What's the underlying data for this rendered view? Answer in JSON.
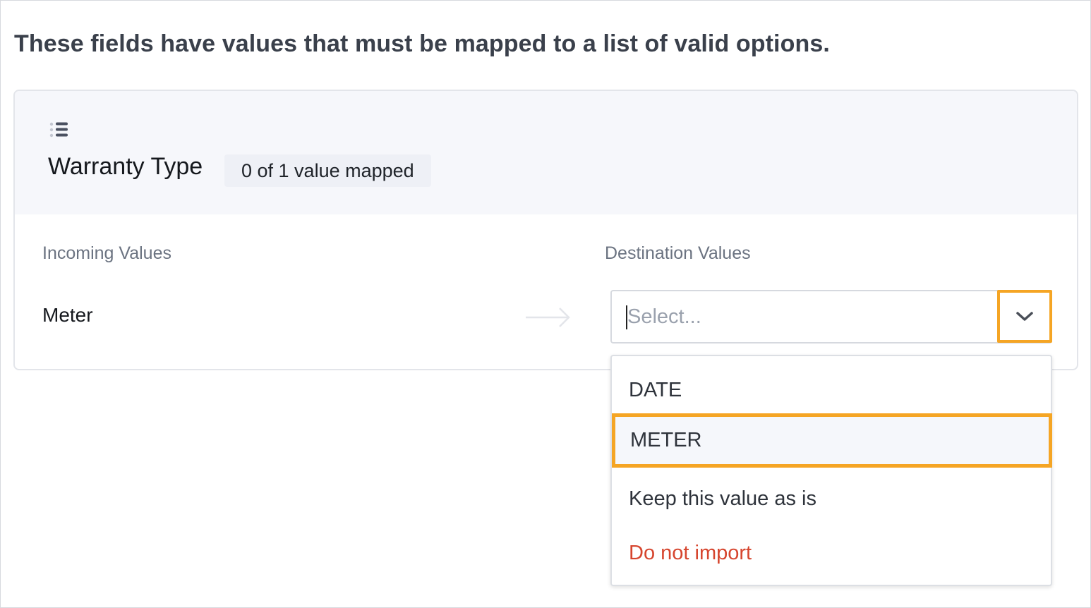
{
  "heading": "These fields have values that must be mapped to a list of valid options.",
  "field": {
    "icon": "list-icon",
    "name": "Warranty Type",
    "mapped_status": "0 of 1 value mapped"
  },
  "columns": {
    "incoming": "Incoming Values",
    "destination": "Destination Values"
  },
  "row": {
    "incoming_value": "Meter",
    "arrow_icon": "arrow-right-icon",
    "select": {
      "value": "",
      "placeholder": "Select...",
      "toggle_icon": "chevron-down-icon"
    }
  },
  "dropdown": {
    "options": [
      {
        "label": "DATE"
      },
      {
        "label": "METER",
        "highlighted": true
      },
      {
        "label": "Keep this value as is"
      },
      {
        "label": "Do not import",
        "style": "danger"
      }
    ]
  },
  "colors": {
    "highlight": "#f5a524",
    "danger": "#d6452e",
    "header_bg": "#f6f7fb"
  }
}
